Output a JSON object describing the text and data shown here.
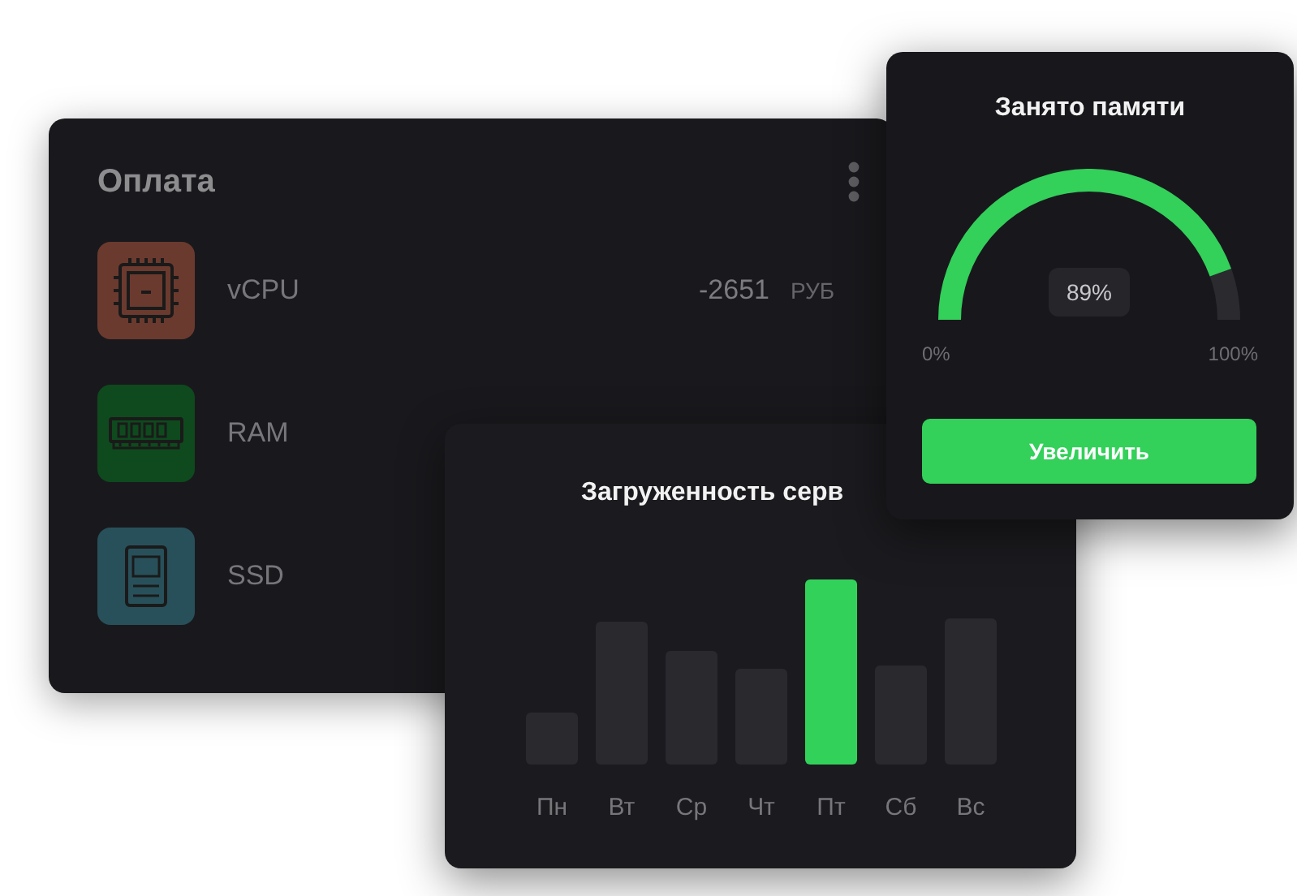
{
  "payment_card": {
    "title": "Оплата",
    "items": [
      {
        "kind": "cpu",
        "name": "vCPU",
        "color": "#6b3a2e",
        "amount": "-2651",
        "currency": "РУБ"
      },
      {
        "kind": "ram",
        "name": "RAM",
        "color": "#0e4a1d"
      },
      {
        "kind": "ssd",
        "name": "SSD",
        "color": "#28505b"
      }
    ]
  },
  "server_load_card": {
    "title": "Загруженность серв",
    "days": [
      {
        "label": "Пн",
        "selected": false
      },
      {
        "label": "Вт",
        "selected": false
      },
      {
        "label": "Ср",
        "selected": false
      },
      {
        "label": "Чт",
        "selected": false
      },
      {
        "label": "Пт",
        "selected": true
      },
      {
        "label": "Сб",
        "selected": false
      },
      {
        "label": "Вс",
        "selected": false
      }
    ]
  },
  "memory_card": {
    "title": "Занято памяти",
    "reading": "89%",
    "min_label": "0%",
    "max_label": "100%",
    "button": "Увеличить"
  }
}
